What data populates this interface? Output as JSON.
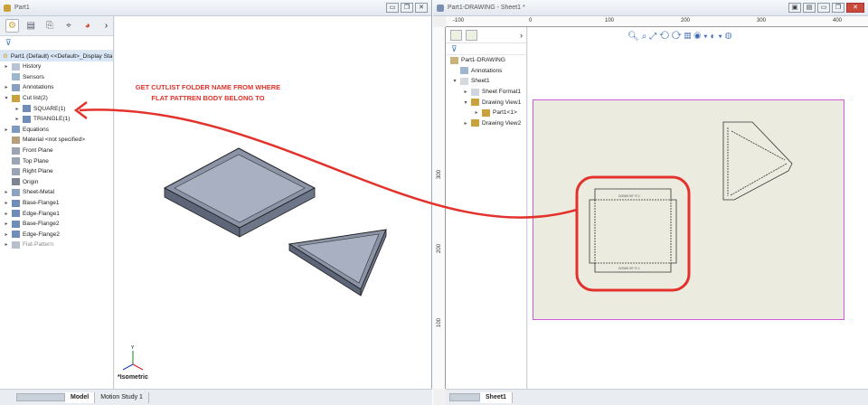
{
  "left_window": {
    "title": "Part1",
    "fm_root": "Part1 (Default) <<Default>_Display Sta",
    "tree": [
      {
        "label": "History",
        "indent": 0,
        "arrow": "▸"
      },
      {
        "label": "Sensors",
        "indent": 0,
        "arrow": ""
      },
      {
        "label": "Annotations",
        "indent": 0,
        "arrow": "▸"
      },
      {
        "label": "Cut list(2)",
        "indent": 0,
        "arrow": "▾"
      },
      {
        "label": "SQUARE(1)",
        "indent": 1,
        "arrow": "▸"
      },
      {
        "label": "TRIANGLE(1)",
        "indent": 1,
        "arrow": "▸"
      },
      {
        "label": "Equations",
        "indent": 0,
        "arrow": "▸"
      },
      {
        "label": "Material <not specified>",
        "indent": 0,
        "arrow": ""
      },
      {
        "label": "Front Plane",
        "indent": 0,
        "arrow": ""
      },
      {
        "label": "Top Plane",
        "indent": 0,
        "arrow": ""
      },
      {
        "label": "Right Plane",
        "indent": 0,
        "arrow": ""
      },
      {
        "label": "Origin",
        "indent": 0,
        "arrow": ""
      },
      {
        "label": "Sheet-Metal",
        "indent": 0,
        "arrow": "▸"
      },
      {
        "label": "Base-Flange1",
        "indent": 0,
        "arrow": "▸"
      },
      {
        "label": "Edge-Flange1",
        "indent": 0,
        "arrow": "▸"
      },
      {
        "label": "Base-Flange2",
        "indent": 0,
        "arrow": "▸"
      },
      {
        "label": "Edge-Flange2",
        "indent": 0,
        "arrow": "▸"
      },
      {
        "label": "Flat-Pattern",
        "indent": 0,
        "arrow": "▸"
      }
    ],
    "view_label": "*Isometric",
    "tabs": [
      "Model",
      "Motion Study 1"
    ],
    "annotation": "GET CUTLIST FOLDER NAME FROM WHERE FLAT PATTREN BODY BELONG TO"
  },
  "right_window": {
    "title": "Part1-DRAWING - Sheet1 *",
    "ruler_top": [
      "-100",
      "0",
      "100",
      "200",
      "300",
      "400"
    ],
    "ruler_left": [
      "300",
      "200",
      "100"
    ],
    "dm_root": "Part1-DRAWING",
    "tree": [
      {
        "label": "Annotations",
        "indent": 0,
        "arrow": ""
      },
      {
        "label": "Sheet1",
        "indent": 0,
        "arrow": "▾"
      },
      {
        "label": "Sheet Format1",
        "indent": 1,
        "arrow": "▸"
      },
      {
        "label": "Drawing View1",
        "indent": 1,
        "arrow": "▾"
      },
      {
        "label": "Part1<1>",
        "indent": 2,
        "arrow": "▸"
      },
      {
        "label": "Drawing View2",
        "indent": 1,
        "arrow": "▸"
      }
    ],
    "sheet_tab": "Sheet1",
    "bend_note": "DOWN 90° R 1"
  },
  "colors": {
    "accent_red": "#e3322b",
    "sheet_border": "#d15ad6",
    "sheet_bg": "#ecebe0"
  }
}
